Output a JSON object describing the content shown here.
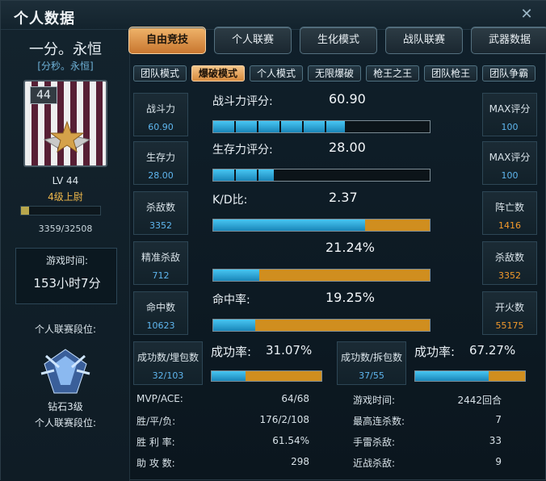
{
  "window": {
    "title": "个人数据",
    "close_label": "✕"
  },
  "player": {
    "name": "一分。永恒",
    "sub": "[分秒。永恒]",
    "level": "44",
    "lv_label": "LV 44",
    "rank": "4级上尉",
    "exp": "3359/32508",
    "exp_fraction": 0.1033,
    "playtime_label": "游戏时间:",
    "playtime_value": "153小时7分",
    "league_label": "个人联赛段位:",
    "tier": "钻石3级",
    "league_label2": "个人联赛段位:"
  },
  "tabs": [
    "自由竞技",
    "个人联赛",
    "生化模式",
    "战队联赛",
    "武器数据"
  ],
  "subtabs": [
    "团队模式",
    "爆破模式",
    "个人模式",
    "无限爆破",
    "枪王之王",
    "团队枪王",
    "团队争霸"
  ],
  "stats": {
    "combat": {
      "left_k": "战斗力",
      "left_v": "60.90",
      "label": "战斗力评分:",
      "value": "60.90",
      "right_k": "MAX评分",
      "right_v": "100",
      "fraction": 0.609
    },
    "survive": {
      "left_k": "生存力",
      "left_v": "28.00",
      "label": "生存力评分:",
      "value": "28.00",
      "right_k": "MAX评分",
      "right_v": "100",
      "fraction": 0.28
    },
    "kd": {
      "left_k": "杀敌数",
      "left_v": "3352",
      "label": "K/D比:",
      "value": "2.37",
      "right_k": "阵亡数",
      "right_v": "1416",
      "fraction": 0.703
    },
    "precision": {
      "left_k": "精准杀敌",
      "left_v": "712",
      "label": "",
      "value": "21.24%",
      "right_k": "杀敌数",
      "right_v": "3352",
      "fraction": 0.2124
    },
    "hit": {
      "left_k": "命中数",
      "left_v": "10623",
      "label": "命中率:",
      "value": "19.25%",
      "right_k": "开火数",
      "right_v": "55175",
      "fraction": 0.1925
    },
    "bomb_plant": {
      "k": "成功数/埋包数",
      "v": "32/103",
      "label": "成功率:",
      "value": "31.07%",
      "fraction": 0.3107
    },
    "bomb_defuse": {
      "k": "成功数/拆包数",
      "v": "37/55",
      "label": "成功率:",
      "value": "67.27%",
      "fraction": 0.6727
    }
  },
  "bottom": {
    "mvp": {
      "k": "MVP/ACE:",
      "v": "64/68"
    },
    "wld": {
      "k": "胜/平/负:",
      "v": "176/2/108"
    },
    "winrate": {
      "k": "胜 利 率:",
      "v": "61.54%"
    },
    "assist": {
      "k": "助 攻 数:",
      "v": "298"
    },
    "rounds": {
      "k": "游戏时间:",
      "v": "2442回合"
    },
    "streak": {
      "k": "最高连杀数:",
      "v": "7"
    },
    "grenade": {
      "k": "手雷杀敌:",
      "v": "33"
    },
    "melee": {
      "k": "近战杀敌:",
      "v": "9"
    }
  }
}
